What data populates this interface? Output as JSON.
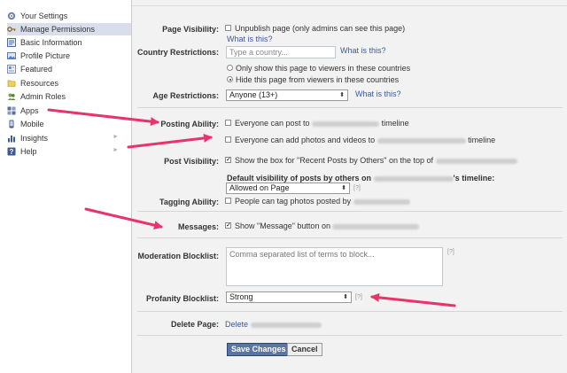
{
  "sidebar": {
    "items": [
      {
        "label": "Your Settings",
        "icon": "gear-icon",
        "color": "#6d84b4",
        "arrow": false
      },
      {
        "label": "Manage Permissions",
        "icon": "key-icon",
        "color": "#8b6a2f",
        "arrow": false
      },
      {
        "label": "Basic Information",
        "icon": "info-icon",
        "color": "#4a6aa5",
        "arrow": false
      },
      {
        "label": "Profile Picture",
        "icon": "picture-icon",
        "color": "#5a7bb5",
        "arrow": false
      },
      {
        "label": "Featured",
        "icon": "featured-icon",
        "color": "#7a8fb8",
        "arrow": false
      },
      {
        "label": "Resources",
        "icon": "resources-icon",
        "color": "#c7a32b",
        "arrow": false
      },
      {
        "label": "Admin Roles",
        "icon": "admin-roles-icon",
        "color": "#5b7d3a",
        "arrow": false
      },
      {
        "label": "Apps",
        "icon": "apps-icon",
        "color": "#5a6f9a",
        "arrow": false
      },
      {
        "label": "Mobile",
        "icon": "mobile-icon",
        "color": "#4a5a7a",
        "arrow": false
      },
      {
        "label": "Insights",
        "icon": "insights-icon",
        "color": "#3b5998",
        "arrow": true
      },
      {
        "label": "Help",
        "icon": "help-icon",
        "color": "#3b5998",
        "arrow": true
      }
    ]
  },
  "settings": {
    "page_visibility": {
      "label": "Page Visibility:",
      "checkbox_text": "Unpublish page (only admins can see this page)",
      "help_link": "What is this?"
    },
    "country_restrictions": {
      "label": "Country Restrictions:",
      "input_placeholder": "Type a country...",
      "help_link": "What is this?",
      "option_only": "Only show this page to viewers in these countries",
      "option_hide": "Hide this page from viewers in these countries",
      "selected": "hide"
    },
    "age_restrictions": {
      "label": "Age Restrictions:",
      "selected_value": "Anyone (13+)",
      "help_link": "What is this?"
    },
    "posting_ability": {
      "label": "Posting Ability:",
      "option1_prefix": "Everyone can post to",
      "option1_suffix": "timeline",
      "option2_prefix": "Everyone can add photos and videos to",
      "option2_suffix": "timeline"
    },
    "post_visibility": {
      "label": "Post Visibility:",
      "checkbox_text": "Show the box for \"Recent Posts by Others\" on the top of",
      "default_visibility_prefix": "Default visibility of posts by others on",
      "default_visibility_suffix": "'s timeline:",
      "selected_value": "Allowed on Page"
    },
    "tagging_ability": {
      "label": "Tagging Ability:",
      "checkbox_text": "People can tag photos posted by"
    },
    "messages": {
      "label": "Messages:",
      "checkbox_text": "Show \"Message\" button on"
    },
    "moderation_blocklist": {
      "label": "Moderation Blocklist:",
      "placeholder": "Comma separated list of terms to block..."
    },
    "profanity_blocklist": {
      "label": "Profanity Blocklist:",
      "selected_value": "Strong"
    },
    "delete_page": {
      "label": "Delete Page:",
      "link": "Delete"
    },
    "help_marker": "[?]",
    "check_mark": "✓",
    "caret": "⬍"
  },
  "buttons": {
    "save": "Save Changes",
    "cancel": "Cancel"
  },
  "colors": {
    "link": "#3b5998",
    "annotation_arrow": "#e8336c",
    "selected_nav_bg": "#d8dfea",
    "primary_button": "#5b74a8"
  }
}
